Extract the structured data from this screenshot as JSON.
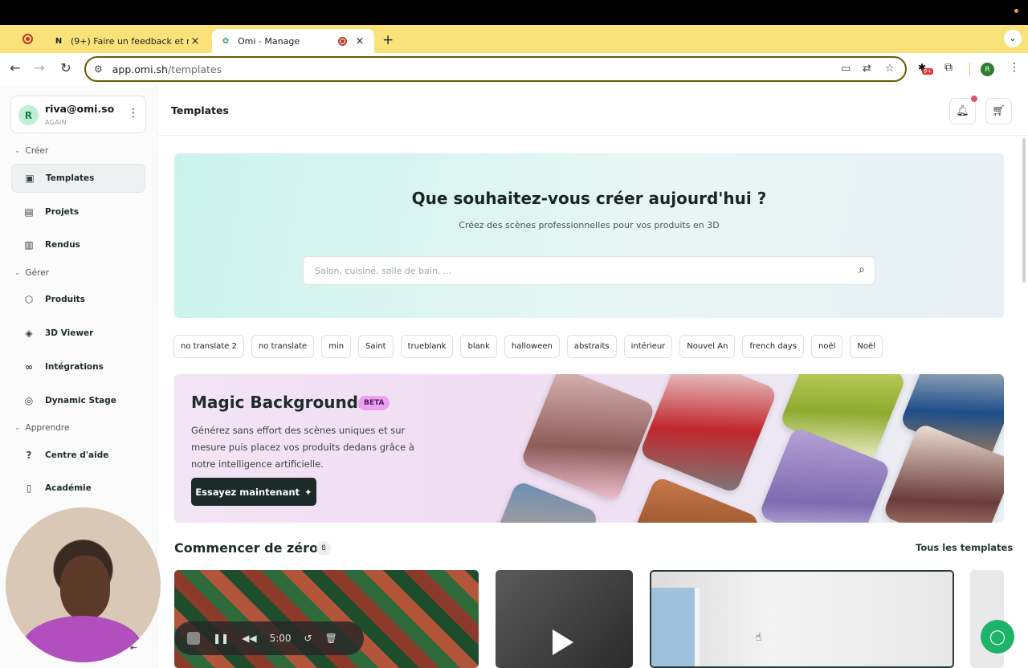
{
  "browser": {
    "tabs": [
      {
        "label": "(9+) Faire un feedback et refu",
        "favicon": "N"
      },
      {
        "label": "Omi - Manage",
        "favicon": "omi"
      }
    ],
    "url_host": "app.omi.sh",
    "url_path": "/templates",
    "profile_initial": "R",
    "ext_badge": "9+"
  },
  "sidebar": {
    "user_name": "riva@omi.so",
    "user_sub": "AGAIN",
    "avatar_initial": "R",
    "sections": [
      {
        "label": "Créer"
      },
      {
        "label": "Gérer"
      },
      {
        "label": "Apprendre"
      }
    ],
    "items": [
      {
        "label": "Templates",
        "icon": "image-icon"
      },
      {
        "label": "Projets",
        "icon": "gallery-icon"
      },
      {
        "label": "Rendus",
        "icon": "images-icon"
      },
      {
        "label": "Produits",
        "icon": "box-icon"
      },
      {
        "label": "3D Viewer",
        "icon": "cube-icon"
      },
      {
        "label": "Intégrations",
        "icon": "link-icon"
      },
      {
        "label": "Dynamic Stage",
        "icon": "stage-icon"
      },
      {
        "label": "Centre d'aide",
        "icon": "help-icon"
      },
      {
        "label": "Académie",
        "icon": "book-icon"
      }
    ]
  },
  "header": {
    "title": "Templates"
  },
  "hero": {
    "title": "Que souhaitez-vous créer aujourd'hui ?",
    "subtitle": "Créez des scènes professionnelles pour vos produits en 3D",
    "search_placeholder": "Salon, cuisine, salle de bain, ..."
  },
  "chips": [
    "no translate 2",
    "no translate",
    "min",
    "Saint",
    "trueblank",
    "blank",
    "halloween",
    "abstraits",
    "intérieur",
    "Nouvel An",
    "french days",
    "noël",
    "Noël"
  ],
  "magic": {
    "title": "Magic Backgrounds",
    "badge": "BETA",
    "description": "Générez sans effort des scènes uniques et sur mesure puis placez vos produits dedans grâce à notre intelligence artificielle.",
    "cta": "Essayez maintenant"
  },
  "zero": {
    "title": "Commencer de zéro",
    "count": "8",
    "all_link": "Tous les templates"
  },
  "recorder": {
    "time": "5:00"
  }
}
